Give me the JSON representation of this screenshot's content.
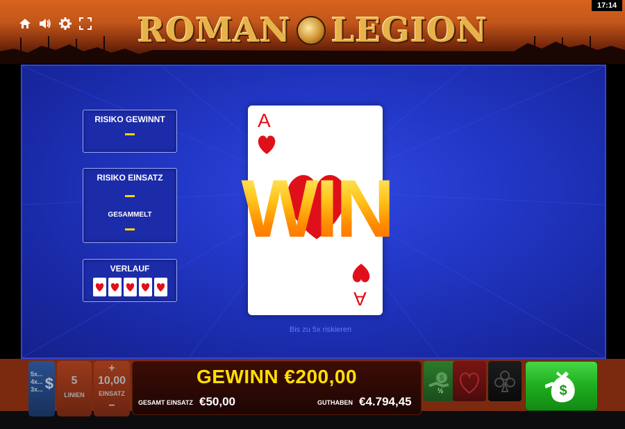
{
  "header": {
    "clock": "17:14",
    "logo_left": "ROMAN",
    "logo_right": "LEGION",
    "icons": [
      "home-icon",
      "speaker-icon",
      "gear-icon",
      "fullscreen-icon"
    ]
  },
  "gamble": {
    "risk_win_label": "RISIKO GEWINNT",
    "risk_win_value": "—",
    "risk_stake_label": "RISIKO EINSATZ",
    "risk_stake_value": "—",
    "collected_label": "GESAMMELT",
    "collected_value": "—",
    "history_label": "VERLAUF",
    "history_cards": [
      "hearts",
      "hearts",
      "hearts",
      "hearts",
      "hearts"
    ],
    "card_rank": "A",
    "card_suit": "hearts",
    "win_text": "WIN",
    "hint": "Bis zu 5x riskieren"
  },
  "controls": {
    "multiplier_options": [
      "5x...",
      "4x...",
      "3x..."
    ],
    "multiplier_icon": "dollar-icon",
    "lines_value": "5",
    "lines_label": "LINIEN",
    "stake_plus": "+",
    "stake_value": "10,00",
    "stake_label": "EINSATZ",
    "stake_minus": "−",
    "win_label": "GEWINN",
    "win_value": "€200,00",
    "total_stake_label": "GESAMT EINSATZ",
    "total_stake_value": "€50,00",
    "balance_label": "GUTHABEN",
    "balance_value": "€4.794,45",
    "half_label": "½",
    "collect_icon": "money-bag-hand-icon"
  },
  "colors": {
    "accent_yellow": "#ffe000",
    "card_red": "#e0101a",
    "collect_green": "#20b020",
    "table_blue": "#2238c8"
  }
}
